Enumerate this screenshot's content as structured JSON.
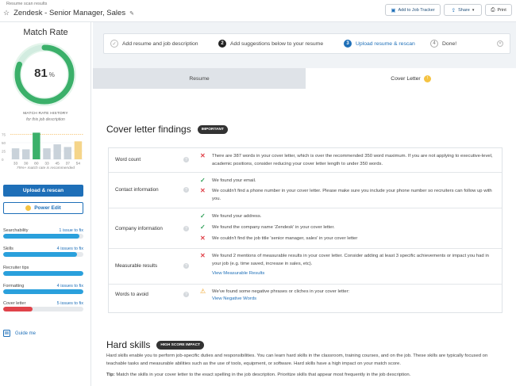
{
  "header": {
    "breadcrumb": "Resume scan results",
    "title": "Zendesk - Senior Manager, Sales",
    "buttons": {
      "job_tracker": "Add to Job Tracker",
      "share": "Share",
      "print": "Print"
    }
  },
  "sidebar": {
    "match_rate_title": "Match Rate",
    "match_rate_value": "81",
    "match_rate_unit": "%",
    "match_rate_fraction": 0.81,
    "history_title": "MATCH RATE HISTORY",
    "history_subtitle": "for this job description",
    "history_note": "75%+ match rate is recommended",
    "upload_button": "Upload & rescan",
    "power_edit_button": "Power Edit",
    "categories": [
      {
        "label": "Searchability",
        "issues": "1 issue to fix",
        "fill": 0.95,
        "color": "#2aa0dc"
      },
      {
        "label": "Skills",
        "issues": "4 issues to fix",
        "fill": 0.92,
        "color": "#2aa0dc"
      },
      {
        "label": "Recruiter tips",
        "issues": "",
        "fill": 1.0,
        "color": "#2aa0dc"
      },
      {
        "label": "Formatting",
        "issues": "4 issues to fix",
        "fill": 1.0,
        "color": "#2aa0dc"
      },
      {
        "label": "Cover letter",
        "issues": "5 issues to fix",
        "fill": 0.37,
        "color": "#e0434a"
      }
    ],
    "guide_label": "Guide me"
  },
  "chart_data": {
    "type": "bar",
    "title": "MATCH RATE HISTORY",
    "subtitle": "for this job description",
    "yticks": [
      "75",
      "50",
      "25",
      "0"
    ],
    "ylim": [
      0,
      100
    ],
    "categories": [
      "33",
      "30",
      "80",
      "33",
      "45",
      "37",
      "54"
    ],
    "values": [
      33,
      30,
      80,
      33,
      45,
      37,
      54
    ],
    "colors": [
      "#c9d2da",
      "#c9d2da",
      "#3bb06a",
      "#c9d2da",
      "#c9d2da",
      "#c9d2da",
      "#f5d58a"
    ],
    "reference_line": 75,
    "annotation": "75%+ match rate is recommended"
  },
  "steps": [
    {
      "label": "Add resume and job description",
      "marker": "✓"
    },
    {
      "label": "Add suggestions below to your resume",
      "marker": "2"
    },
    {
      "label": "Upload resume & rescan",
      "marker": "3"
    },
    {
      "label": "Done!",
      "marker": "4"
    }
  ],
  "tabs": {
    "resume": "Resume",
    "cover_letter": "Cover Letter",
    "cover_badge": "!"
  },
  "findings": {
    "title": "Cover letter findings",
    "badge": "IMPORTANT",
    "rows": [
      {
        "label": "Word count",
        "items": [
          {
            "status": "x",
            "text": "There are 387 words in your cover letter, which is over the recommended 350 word maximum. If you are not applying to executive-level, academic positions, consider reducing your cover letter length to under 350 words."
          }
        ],
        "link": ""
      },
      {
        "label": "Contact information",
        "items": [
          {
            "status": "ok",
            "text": "We found your email."
          },
          {
            "status": "x",
            "text": "We couldn't find a phone number in your cover letter. Please make sure you include your phone number so recruiters can follow up with you."
          }
        ],
        "link": ""
      },
      {
        "label": "Company information",
        "items": [
          {
            "status": "ok",
            "text": "We found your address."
          },
          {
            "status": "ok",
            "text": "We found the company name 'Zendesk' in your cover letter."
          },
          {
            "status": "x",
            "text": "We couldn't find the job title 'senior manager, sales' in your cover letter"
          }
        ],
        "link": ""
      },
      {
        "label": "Measurable results",
        "items": [
          {
            "status": "x",
            "text": "We found 2 mentions of measurable results in your cover letter. Consider adding at least 3 specific achievements or impact you had in your job (e.g. time saved, increase in sales, etc)."
          }
        ],
        "link": "View Measurable Results"
      },
      {
        "label": "Words to avoid",
        "items": [
          {
            "status": "warn",
            "text": "We've found some negative phrases or cliches in your cover letter:"
          }
        ],
        "link": "View Negative Words"
      }
    ]
  },
  "hard_skills": {
    "title": "Hard skills",
    "badge": "HIGH SCORE IMPACT",
    "description": "Hard skills enable you to perform job-specific duties and responsibilities. You can learn hard skills in the classroom, training courses, and on the job. These skills are typically focused on teachable tasks and measurable abilities such as the use of tools, equipment, or software. Hard skills have a high impact on your match score.",
    "tip_label": "Tip:",
    "tip_text": "Match the skills in your cover letter to the exact spelling in the job description. Prioritize skills that appear most frequently in the job description."
  }
}
